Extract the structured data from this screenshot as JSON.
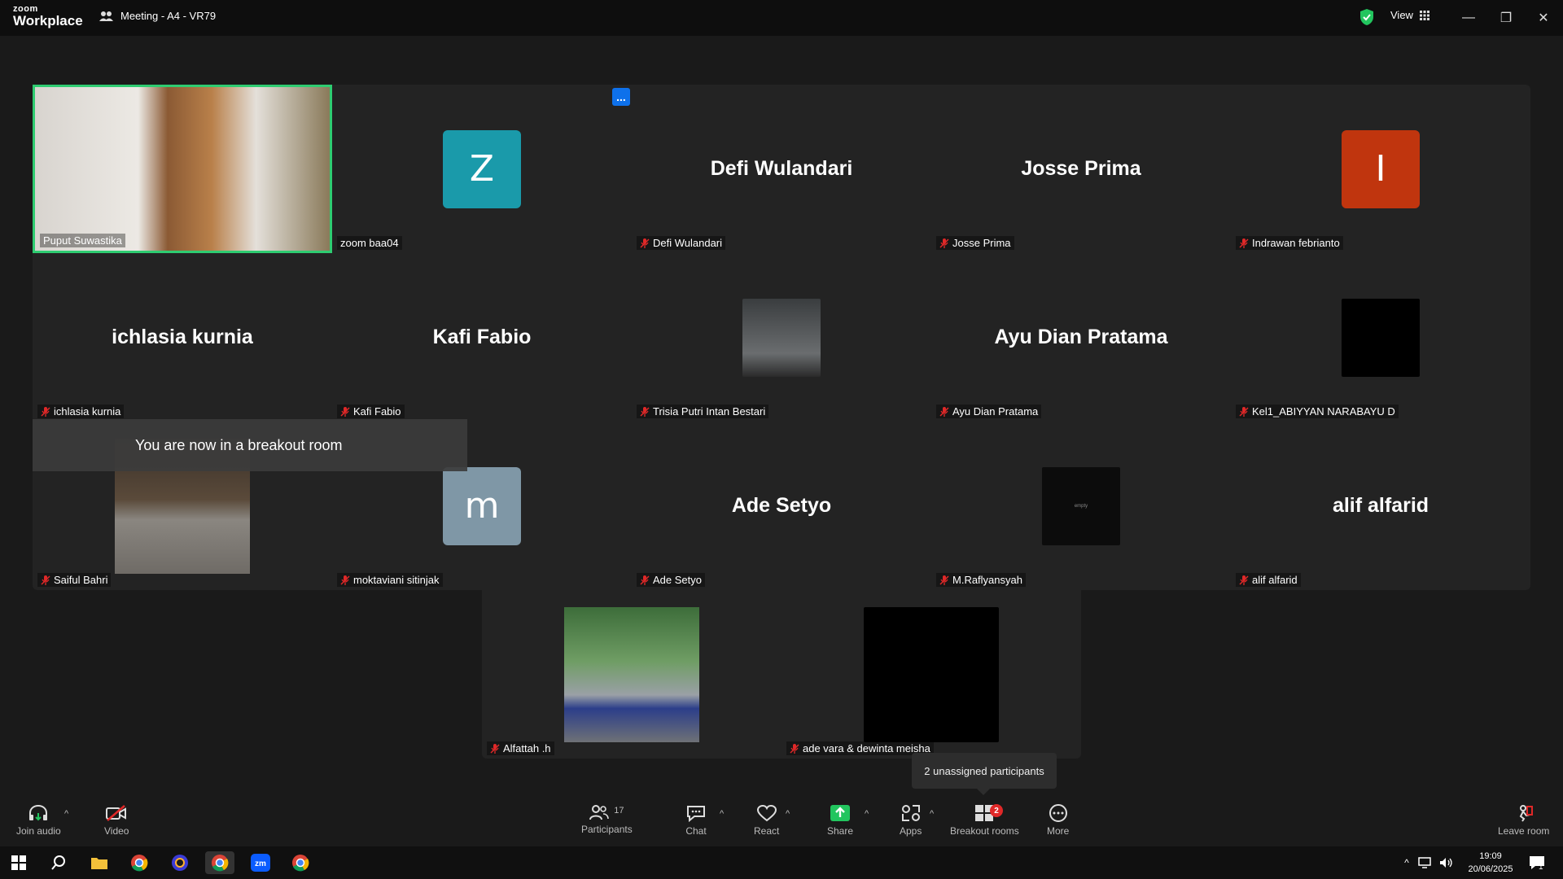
{
  "app": {
    "logo_line1": "zoom",
    "logo_line2": "Workplace",
    "meeting_title": "Meeting - A4 - VR79",
    "view_label": "View"
  },
  "gallery": {
    "more_button_label": "...",
    "tiles": [
      {
        "name": "Puput Suwastika",
        "type": "video",
        "muted": false,
        "active_speaker": true
      },
      {
        "name": "zoom baa04",
        "type": "avatar",
        "avatar_letter": "Z",
        "avatar_color": "#1a9aaa",
        "muted": false
      },
      {
        "name": "Defi Wulandari",
        "type": "name",
        "big_name": "Defi Wulandari",
        "muted": true
      },
      {
        "name": "Josse Prima",
        "type": "name",
        "big_name": "Josse Prima",
        "muted": true
      },
      {
        "name": "Indrawan febrianto",
        "type": "avatar",
        "avatar_letter": "I",
        "avatar_color": "#c0350e",
        "muted": true
      },
      {
        "name": "ichlasia kurnia",
        "type": "name",
        "big_name": "ichlasia kurnia",
        "muted": true
      },
      {
        "name": "Kafi Fabio",
        "type": "name",
        "big_name": "Kafi Fabio",
        "muted": true
      },
      {
        "name": "Trisia Putri Intan Bestari",
        "type": "thumb",
        "muted": true
      },
      {
        "name": "Ayu Dian Pratama",
        "type": "name",
        "big_name": "Ayu Dian Pratama",
        "muted": true
      },
      {
        "name": "Kel1_ABIYYAN NARABAYU D",
        "type": "thumb-black",
        "muted": true
      },
      {
        "name": "Saiful Bahri",
        "type": "photo",
        "muted": true
      },
      {
        "name": "moktaviani sitinjak",
        "type": "avatar",
        "avatar_letter": "m",
        "avatar_color": "#7f97a6",
        "muted": true
      },
      {
        "name": "Ade Setyo",
        "type": "name",
        "big_name": "Ade Setyo",
        "muted": true
      },
      {
        "name": "M.Raflyansyah",
        "type": "thumb-dark",
        "thumb_text": "empty",
        "muted": true
      },
      {
        "name": "alif alfarid",
        "type": "name",
        "big_name": "alif alfarid",
        "muted": true
      },
      {
        "name": "Alfattah .h",
        "type": "photo",
        "muted": true
      },
      {
        "name": "ade vara & dewinta meisha",
        "type": "thumb-black",
        "muted": true
      }
    ]
  },
  "notification": {
    "breakout_toast": "You are now in a breakout room",
    "unassigned_tooltip": "2 unassigned participants"
  },
  "toolbar": {
    "join_audio": "Join audio",
    "video": "Video",
    "participants": "Participants",
    "participants_count": "17",
    "chat": "Chat",
    "react": "React",
    "share": "Share",
    "apps": "Apps",
    "breakout_rooms": "Breakout rooms",
    "breakout_badge": "2",
    "more": "More",
    "leave_room": "Leave room"
  },
  "taskbar": {
    "time": "19:09",
    "date": "20/06/2025",
    "notification_count": "1"
  },
  "colors": {
    "accent_green": "#2ecc71",
    "share_green": "#22c55e",
    "mute_red": "#e02828",
    "zoom_blue": "#0e71eb"
  }
}
